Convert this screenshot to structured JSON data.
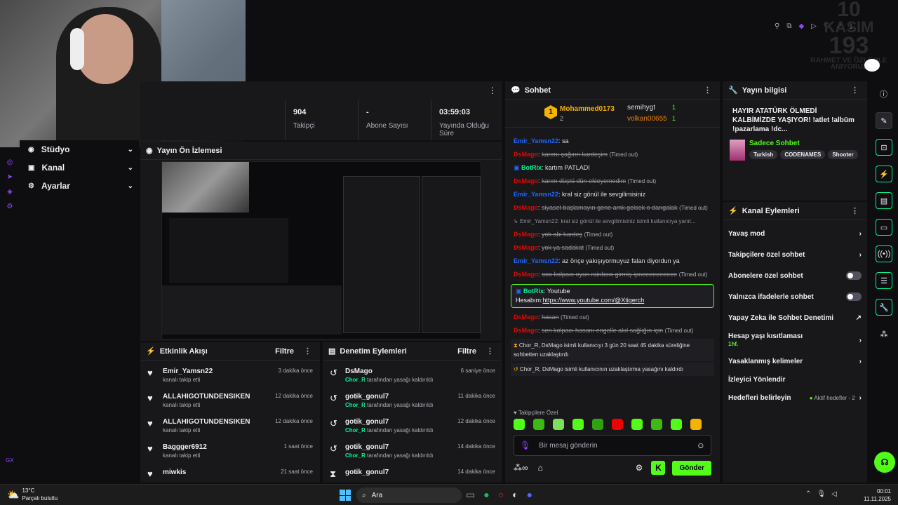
{
  "stats": [
    {
      "value": "904",
      "label": "Takipçi"
    },
    {
      "value": "-",
      "label": "Abone Sayısı"
    },
    {
      "value": "03:59:03",
      "label": "Yayında Olduğu Süre"
    }
  ],
  "left_nav": {
    "items": [
      {
        "label": "Stüdyo"
      },
      {
        "label": "Kanal"
      },
      {
        "label": "Ayarlar"
      }
    ],
    "gx": "GX"
  },
  "preview": {
    "title": "Yayın Ön İzlemesi"
  },
  "chat": {
    "title": "Sohbet",
    "leaderboard": [
      {
        "rank": "1",
        "name": "Mohammed0173",
        "points": "2"
      },
      {
        "name": "semihygt",
        "points": "1"
      },
      {
        "name": "volkan00655",
        "points": "1"
      }
    ],
    "messages": [
      {
        "user": "Emir_Yamsn22",
        "text": ": sa",
        "color": "#1f69ff",
        "deleted": false
      },
      {
        "user": "DsMago",
        "text": "karımı çağırın kardeşim",
        "color": "#eb0400",
        "deleted": true,
        "note": "(Timed out)"
      },
      {
        "user": "BotRix",
        "text": ": kartım PATLADI",
        "color": "#00f593",
        "deleted": false,
        "bot": true
      },
      {
        "user": "DsMago",
        "text": "karım düştü dün ekleyemedim",
        "color": "#eb0400",
        "deleted": true,
        "note": "(Timed out)"
      },
      {
        "user": "Emir_Yamsn22",
        "text": ": kral siz gönül ile sevgilimisiniz",
        "color": "#1f69ff",
        "deleted": false
      },
      {
        "user": "DsMago",
        "text": "siyaset başlamayın gene amk gelcek o dangalak",
        "color": "#eb0400",
        "deleted": true,
        "note": "(Timed out)"
      }
    ],
    "reply_line": "Emir_Yamsn22: kral siz gönül ile sevgilimisiniz isimli kullanıcıya yanıt...",
    "messages2": [
      {
        "user": "DsMago",
        "text": "yok abi kardeş",
        "color": "#eb0400",
        "deleted": true,
        "note": "(Timed out)"
      },
      {
        "user": "DsMago",
        "text": "yok ya sadakat",
        "color": "#eb0400",
        "deleted": true,
        "note": "(Timed out)"
      },
      {
        "user": "Emir_Yamsn22",
        "text": ": az önçe yakışıyormuyuz falan diyordun ya",
        "color": "#1f69ff",
        "deleted": false
      },
      {
        "user": "DsMago",
        "text": "ooo kolpacı oyun rainbow girmiş ipneeeeeeeeee",
        "color": "#eb0400",
        "deleted": true,
        "note": "(Timed out)"
      }
    ],
    "highlight": {
      "user": "BotRix",
      "text": ": Youtube",
      "line2": "Hesabım:",
      "link": "https://www.youtube.com/@Xtigerch"
    },
    "messages3": [
      {
        "user": "DsMago",
        "text": "hasan",
        "color": "#eb0400",
        "deleted": true,
        "note": "(Timed out)"
      },
      {
        "user": "DsMago",
        "text": "sen kolpacı hasanı engelle akıl sağlığın için",
        "color": "#eb0400",
        "deleted": true,
        "note": "(Timed out)"
      }
    ],
    "system1": {
      "text": "Chor_R, DsMago isimli kullanıcıyı 3 gün 20 saat 45 dakika süreliğine sohbetten uzaklaştırdı"
    },
    "system2": {
      "text": "Chor_R, DsMago isimli kullanıcının uzaklaştırma yasağını kaldırdı"
    },
    "emote_label": "Takipçilere Özel",
    "input_placeholder": "Bir mesaj gönderin",
    "send_label": "Gönder"
  },
  "stream_info": {
    "title": "Yayın bilgisi",
    "stream_title": "HAYIR ATATÜRK ÖLMEDİ KALBİMİZDE YAŞIYOR! !atlet !albüm !pazarlama !dc...",
    "category": "Sadece Sohbet",
    "tags": [
      "Turkish",
      "CODENAMES",
      "Shooter"
    ],
    "overlay_text": [
      "10",
      "KASIM",
      "193",
      "RAHMET VE ÖZLEMLE",
      "ANIYORUZ"
    ]
  },
  "channel_actions": {
    "title": "Kanal Eylemleri",
    "rows": [
      {
        "label": "Yavaş mod",
        "kind": "arrow"
      },
      {
        "label": "Takipçilere özel sohbet",
        "kind": "arrow"
      },
      {
        "label": "Abonelere özel sohbet",
        "kind": "toggle"
      },
      {
        "label": "Yalnızca ifadelerle sohbet",
        "kind": "toggle"
      },
      {
        "label": "Yapay Zeka ile Sohbet Denetimi",
        "kind": "external"
      },
      {
        "label": "Hesap yaşı kısıtlaması",
        "kind": "arrow",
        "sub": "1hf."
      },
      {
        "label": "Yasaklanmış kelimeler",
        "kind": "arrow"
      },
      {
        "label": "İzleyici Yönlendir",
        "kind": "none"
      },
      {
        "label": "Hedefleri belirleyin",
        "kind": "arrow",
        "extra": "Aktif hedefler - 2"
      }
    ]
  },
  "activity": {
    "title": "Etkinlik Akışı",
    "filter": "Filtre",
    "events": [
      {
        "name": "Emir_Yamsn22",
        "sub": "kanalı takip etti",
        "time": "3 dakika önce"
      },
      {
        "name": "ALLAHIGOTUNDENSIKEN",
        "sub": "kanalı takip etti",
        "time": "12 dakika önce"
      },
      {
        "name": "ALLAHIGOTUNDENSIKEN",
        "sub": "kanalı takip etti",
        "time": "12 dakika önce"
      },
      {
        "name": "Baggger6912",
        "sub": "kanalı takip etti",
        "time": "1 saat önce"
      },
      {
        "name": "miwkis",
        "sub": "",
        "time": "21 saat önce"
      }
    ]
  },
  "moderation": {
    "title": "Denetim Eylemleri",
    "filter": "Filtre",
    "events": [
      {
        "name": "DsMago",
        "by": "Chor_R",
        "sub": " tarafından yasağı kaldırıldı",
        "time": "6 saniye önce"
      },
      {
        "name": "gotik_gonul7",
        "by": "Chor_R",
        "sub": " tarafından yasağı kaldırıldı",
        "time": "11 dakika önce"
      },
      {
        "name": "gotik_gonul7",
        "by": "Chor_R",
        "sub": " tarafından yasağı kaldırıldı",
        "time": "12 dakika önce"
      },
      {
        "name": "gotik_gonul7",
        "by": "Chor_R",
        "sub": " tarafından yasağı kaldırıldı",
        "time": "14 dakika önce"
      },
      {
        "name": "gotik_gonul7",
        "by": "",
        "sub": "",
        "time": "14 dakika önce"
      }
    ]
  },
  "taskbar": {
    "weather_temp": "13°C",
    "weather_desc": "Parçalı bulutlu",
    "search": "Ara",
    "time": "00:01",
    "date": "11.11.2025"
  },
  "colors": {
    "accent": "#53fc18",
    "bg": "#0e0e10",
    "panel": "#18181b"
  }
}
